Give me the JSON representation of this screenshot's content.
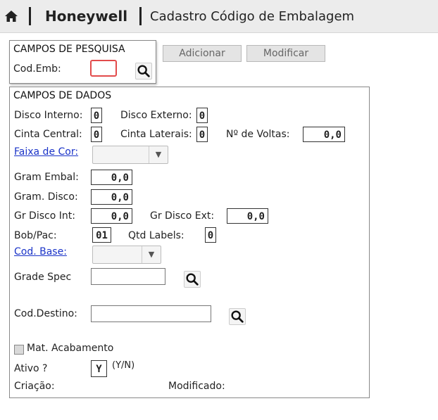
{
  "header": {
    "brand": "Honeywell",
    "title": "Cadastro Código de Embalagem"
  },
  "search": {
    "section_title": "CAMPOS DE PESQUISA",
    "cod_emb_label": "Cod.Emb:",
    "cod_emb_value": ""
  },
  "toolbar": {
    "add_label": "Adicionar",
    "modify_label": "Modificar"
  },
  "data": {
    "section_title": "CAMPOS DE DADOS",
    "disco_interno": {
      "label": "Disco Interno:",
      "value": "0"
    },
    "disco_externo": {
      "label": "Disco Externo:",
      "value": "0"
    },
    "cinta_central": {
      "label": "Cinta Central:",
      "value": "0"
    },
    "cinta_laterais": {
      "label": "Cinta Laterais:",
      "value": "0"
    },
    "n_voltas": {
      "label": "Nº de Voltas:",
      "value": "0,0"
    },
    "faixa_cor": {
      "label": "Faixa de Cor:",
      "value": ""
    },
    "gram_embal": {
      "label": "Gram Embal:",
      "value": "0,0"
    },
    "gram_disco": {
      "label": "Gram. Disco:",
      "value": "0,0"
    },
    "gr_disco_int": {
      "label": "Gr Disco Int:",
      "value": "0,0"
    },
    "gr_disco_ext": {
      "label": "Gr Disco Ext:",
      "value": "0,0"
    },
    "bob_pac": {
      "label": "Bob/Pac:",
      "value": "01"
    },
    "qtd_labels": {
      "label": "Qtd Labels:",
      "value": "0"
    },
    "cod_base": {
      "label": "Cod. Base:",
      "value": ""
    },
    "grade_spec": {
      "label": "Grade Spec",
      "value": ""
    },
    "cod_destino": {
      "label": "Cod.Destino:",
      "value": ""
    },
    "mat_acabamento": {
      "label": "Mat. Acabamento",
      "checked": false
    },
    "ativo": {
      "label": "Ativo ?",
      "value": "Y",
      "hint": "(Y/N)"
    },
    "criacao_label": "Criação:",
    "modificado_label": "Modificado:"
  },
  "icons": {
    "home": "home-icon",
    "search": "search-icon",
    "dropdown": "chevron-down-icon"
  },
  "colors": {
    "topbar": "#ececec",
    "link": "#1a33c8",
    "error_border": "#e24b4b"
  }
}
